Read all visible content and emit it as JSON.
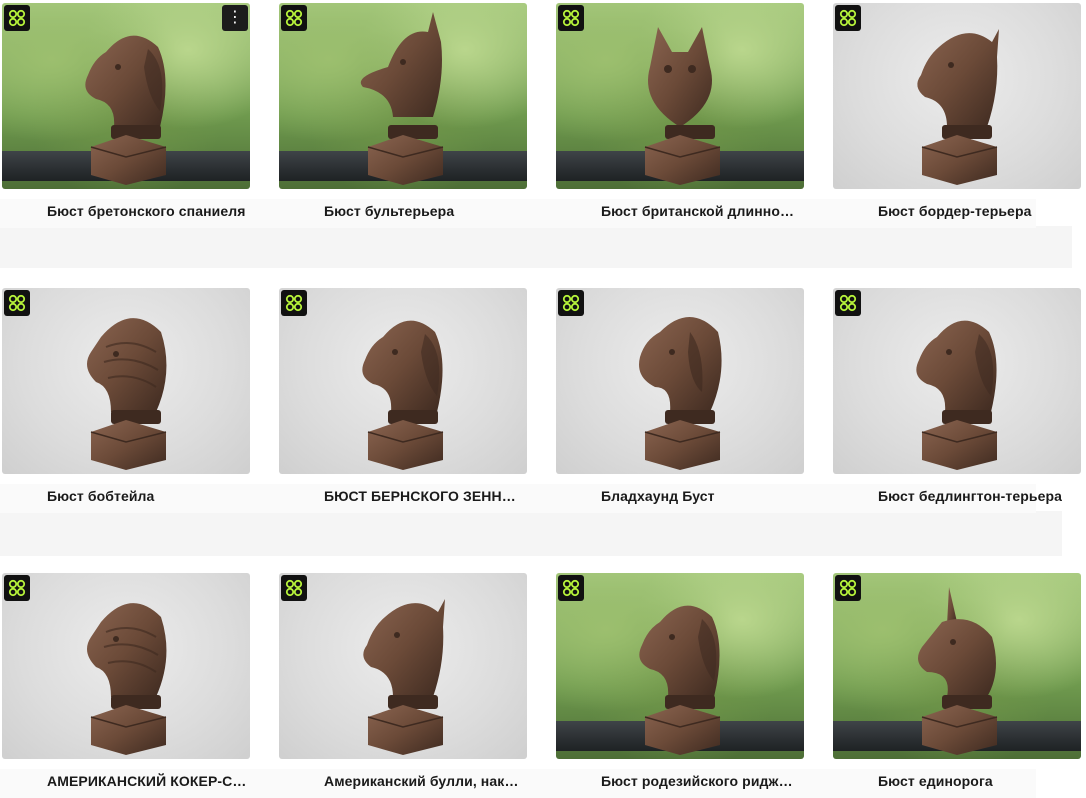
{
  "cards": [
    {
      "title": "Бюст бретонского спаниеля",
      "bg": "outdoor",
      "kind": "dog-floppy",
      "menu": "⋮"
    },
    {
      "title": "Бюст бультерьера",
      "bg": "outdoor",
      "kind": "bullterrier",
      "menu": ""
    },
    {
      "title": "Бюст британской длинношерстной кошки",
      "bg": "outdoor",
      "kind": "cat",
      "menu": ""
    },
    {
      "title": "Бюст бордер-терьера",
      "bg": "studio",
      "kind": "terrier",
      "menu": ""
    },
    {
      "title": "Бюст бобтейла",
      "bg": "studio",
      "kind": "shaggy",
      "menu": ""
    },
    {
      "title": "БЮСТ БЕРНСКОГО ЗЕННЕНХУНДА",
      "bg": "studio",
      "kind": "dog-floppy",
      "menu": ""
    },
    {
      "title": "Бладхаунд Буст",
      "bg": "studio",
      "kind": "hound",
      "menu": ""
    },
    {
      "title": "Бюст бедлингтон-терьера",
      "bg": "studio",
      "kind": "dog-floppy",
      "menu": ""
    },
    {
      "title": "АМЕРИКАНСКИЙ КОКЕР-СПАНИЕЛЬ",
      "bg": "studio",
      "kind": "shaggy",
      "menu": ""
    },
    {
      "title": "Американский булли, наклон",
      "bg": "studio",
      "kind": "terrier",
      "menu": ""
    },
    {
      "title": "Бюст родезийского риджбека",
      "bg": "outdoor",
      "kind": "dog-floppy",
      "menu": ""
    },
    {
      "title": "Бюст единорога",
      "bg": "outdoor",
      "kind": "unicorn",
      "menu": ""
    }
  ],
  "colors": {
    "bronze": "#6b4a38",
    "bronze_dark": "#3e2a20",
    "badge_green": "#b6f23a"
  }
}
